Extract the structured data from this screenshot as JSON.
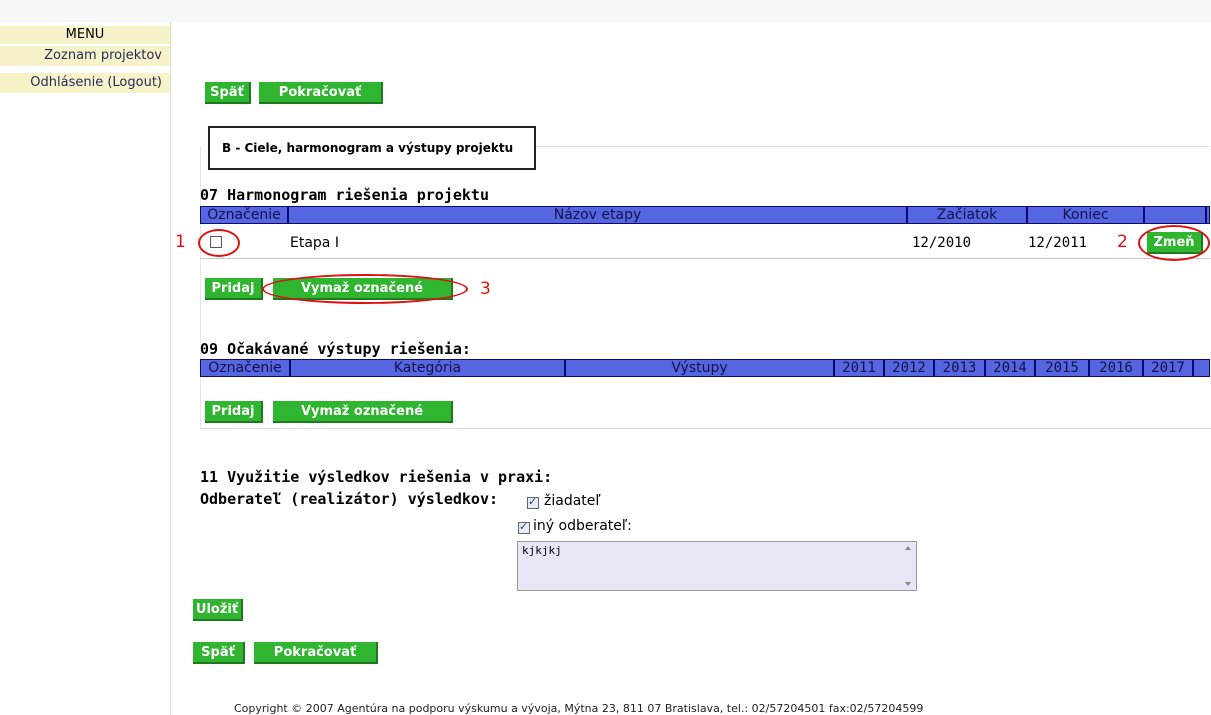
{
  "sidebar": {
    "title": "MENU",
    "items": [
      {
        "label": "Zoznam projektov"
      },
      {
        "label": "Odhlásenie (Logout)"
      }
    ]
  },
  "top_buttons": {
    "back": "Späť",
    "continue": "Pokračovať"
  },
  "section_box": "B - Ciele, harmonogram a výstupy projektu",
  "harmonogram": {
    "title": "07 Harmonogram riešenia projektu",
    "headers": [
      "Označenie",
      "Názov etapy",
      "Začiatok",
      "Koniec",
      ""
    ],
    "rows": [
      {
        "name": "Etapa I",
        "start": "12/2010",
        "end": "12/2011",
        "checked": false,
        "edit_label": "Zmeň"
      }
    ],
    "add_label": "Pridaj",
    "delete_label": "Vymaž označené"
  },
  "annotations": [
    "1",
    "2",
    "3"
  ],
  "outputs": {
    "title": "09 Očakávané výstupy riešenia:",
    "headers": [
      "Označenie",
      "Kategória",
      "Výstupy",
      "2011",
      "2012",
      "2013",
      "2014",
      "2015",
      "2016",
      "2017",
      ""
    ],
    "add_label": "Pridaj",
    "delete_label": "Vymaž označené"
  },
  "usage": {
    "title": "11 Využitie výsledkov riešenia v praxi:",
    "recipient_label": "Odberateľ (realizátor) výsledkov:",
    "options": [
      {
        "label": "žiadateľ",
        "checked": true
      },
      {
        "label": "iný odberateľ:",
        "checked": true
      }
    ],
    "other_text": "kjkjkj"
  },
  "save_label": "Uložiť",
  "bottom_buttons": {
    "back": "Späť",
    "continue": "Pokračovať"
  },
  "footer": "Copyright © 2007 Agentúra na podporu výskumu a vývoja, Mýtna 23, 811 07 Bratislava, tel.: 02/57204501 fax:02/57204599"
}
